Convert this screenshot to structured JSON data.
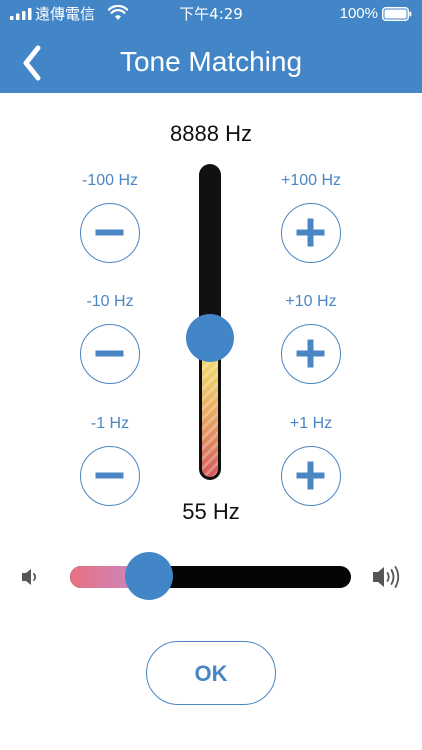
{
  "status_bar": {
    "carrier": "遠傳電信",
    "time": "下午4:29",
    "battery_percent": "100%",
    "icons": [
      "signal-icon",
      "wifi-icon",
      "battery-icon"
    ]
  },
  "nav": {
    "back_icon": "chevron-left-icon",
    "title": "Tone Matching"
  },
  "frequency": {
    "max_label": "8888 Hz",
    "min_label": "55 Hz",
    "slider_level": 0.45,
    "steps": {
      "minus": [
        "-100 Hz",
        "-10 Hz",
        "-1 Hz"
      ],
      "plus": [
        "+100 Hz",
        "+10 Hz",
        "+1 Hz"
      ]
    }
  },
  "volume": {
    "low_icon": "volume-low-icon",
    "high_icon": "volume-high-icon",
    "level": 0.28
  },
  "actions": {
    "ok_label": "OK"
  },
  "colors": {
    "accent": "#4386c8",
    "control_blue": "#4a86c3",
    "track": "#111111"
  }
}
